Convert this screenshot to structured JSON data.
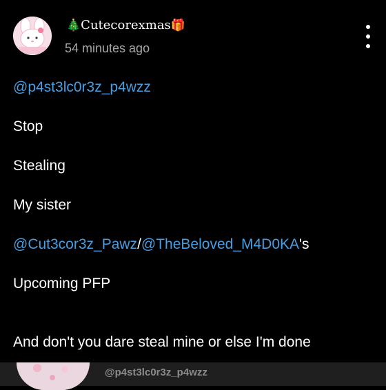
{
  "post": {
    "author": {
      "emoji_left": "🎄",
      "name": "Cutecorexmas",
      "emoji_right": "🎁",
      "avatar_icon": "my-melody-avatar"
    },
    "timestamp": "54 minutes ago",
    "menu_icon": "more-vertical-icon",
    "lines": {
      "mention1": "@p4st3lc0r3z_p4wzz",
      "l2": "Stop",
      "l3": "Stealing",
      "l4": "My sister",
      "mention2": "@Cut3cor3z_Pawz",
      "slash": "/",
      "mention3": "@TheBeloved_M4D0KA",
      "possessive": "'s",
      "l6": "Upcoming PFP",
      "l7": "And don't you dare steal mine or else I'm done"
    }
  },
  "next_post": {
    "mention": "@p4st3lc0r3z_p4wzz",
    "avatar_icon": "my-melody-avatar"
  },
  "colors": {
    "background": "#000000",
    "mention": "#4a9de0",
    "timestamp": "#a7a7a7"
  }
}
